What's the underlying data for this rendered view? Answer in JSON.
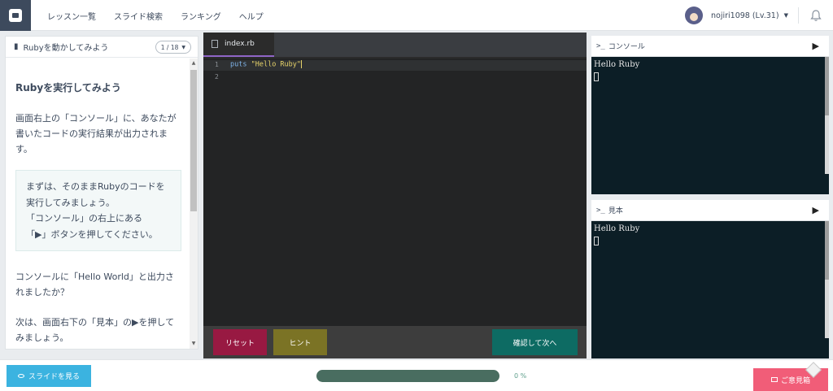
{
  "header": {
    "nav": [
      "レッスン一覧",
      "スライド検索",
      "ランキング",
      "ヘルプ"
    ],
    "user_name": "nojiri1098 (Lv.31)"
  },
  "lesson": {
    "title": "Rubyを動かしてみよう",
    "pager": "1 / 18",
    "slide_title": "Rubyを実行してみよう",
    "para1": "画面右上の「コンソール」に、あなたが書いたコードの実行結果が出力されます。",
    "note_lines": [
      "まずは、そのままRubyのコードを",
      "実行してみましょう。",
      "「コンソール」の右上にある",
      "「▶」ボタンを押してください。"
    ],
    "para2": "コンソールに「Hello World」と出力されましたか？",
    "para3": "次は、画面右下の「見本」の▶を押してみましょう。"
  },
  "editor": {
    "tab_label": "index.rb",
    "line_numbers": [
      "1",
      "2"
    ],
    "code_keyword": "puts",
    "code_string": "\"Hello Ruby\"",
    "reset_label": "リセット",
    "hint_label": "ヒント",
    "next_label": "確認して次へ"
  },
  "console": {
    "title": "コンソール",
    "output": "Hello Ruby"
  },
  "sample": {
    "title": "見本",
    "output": "Hello Ruby"
  },
  "footer": {
    "slides_label": "スライドを見る",
    "progress_percent": 0,
    "progress_label": "0 %",
    "feedback_label": "ご意見箱"
  }
}
